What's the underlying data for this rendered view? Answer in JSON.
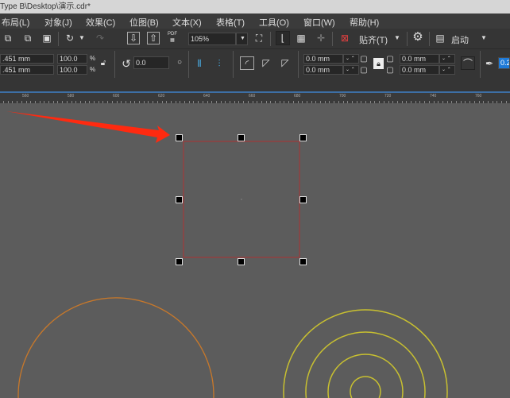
{
  "window": {
    "title": "Type B\\Desktop\\演示.cdr*"
  },
  "menu": [
    {
      "label": "布局(L)"
    },
    {
      "label": "对象(J)"
    },
    {
      "label": "效果(C)"
    },
    {
      "label": "位图(B)"
    },
    {
      "label": "文本(X)"
    },
    {
      "label": "表格(T)"
    },
    {
      "label": "工具(O)"
    },
    {
      "label": "窗口(W)"
    },
    {
      "label": "帮助(H)"
    }
  ],
  "toolbar": {
    "zoom": "105%",
    "snap_label": "贴齐(T)",
    "launch_label": "启动",
    "pdf_label": "PDF"
  },
  "props": {
    "width": ".451 mm",
    "height": ".451 mm",
    "scale_x": "100.0",
    "scale_y": "100.0",
    "pct": "%",
    "rotation": "0.0",
    "corner_1": "0.0 mm",
    "corner_2": "0.0 mm",
    "corner_3": "0.0 mm",
    "corner_4": "0.0 mm",
    "outline": "0.2"
  },
  "ruler": {
    "labels": [
      "560",
      "580",
      "600",
      "620",
      "640",
      "660",
      "680",
      "700",
      "720",
      "740",
      "760"
    ]
  },
  "colors": {
    "selection": "#a03a3a",
    "arrow": "#ff2a10",
    "orange_circle": "#c8782a",
    "yellow_circles": "#c8c030",
    "accent": "#3d6fa5"
  }
}
